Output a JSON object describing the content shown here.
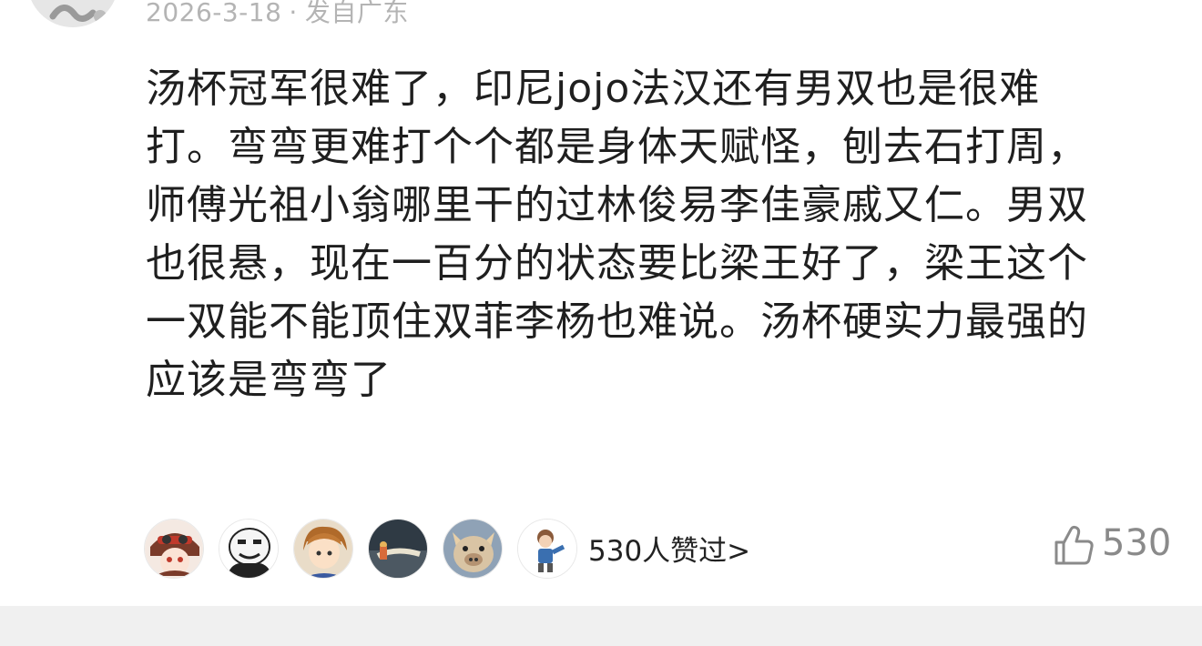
{
  "comment": {
    "meta": {
      "date": "2026-3-18",
      "separator": "·",
      "location": "发自广东"
    },
    "lines": [
      "汤杯冠军很难了，印尼jojo法汉还有男双也是很难",
      "打。弯弯更难打个个都是身体天赋怪，刨去石打周，",
      "师傅光祖小翁哪里干的过林俊易李佳豪戚又仁。男双",
      "也很悬，现在一百分的状态要比梁王好了，梁王这个",
      "一双能不能顶住双菲李杨也难说。汤杯硬实力最强的",
      "应该是弯弯了"
    ],
    "likers_text": "530人赞过>",
    "like_count": "530"
  },
  "icons": {
    "like": "thumbs-up-icon"
  },
  "colors": {
    "meta": "#b4b4b4",
    "text": "#1f1f1f",
    "like": "#8a8a8a",
    "divider": "#f0f0f0"
  }
}
